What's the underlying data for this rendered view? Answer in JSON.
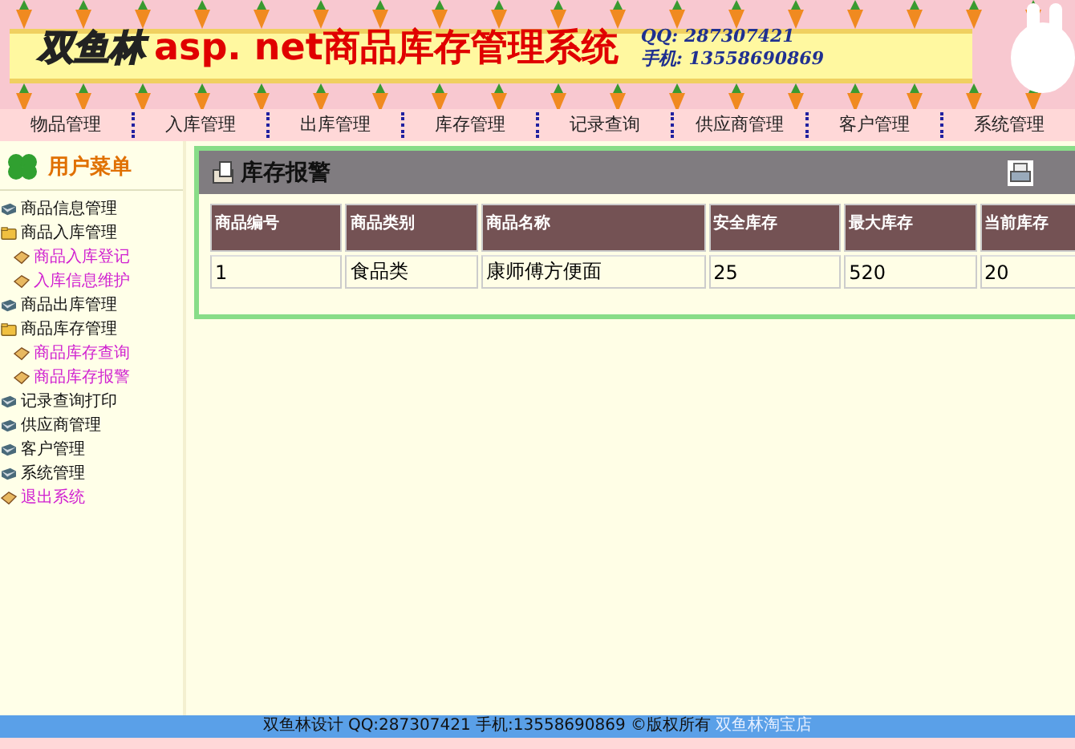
{
  "banner": {
    "brand": "双鱼林",
    "title": "asp. net商品库存管理系统",
    "qq": "QQ: 287307421",
    "phone": "手机: 13558690869"
  },
  "nav": [
    "物品管理",
    "入库管理",
    "出库管理",
    "库存管理",
    "记录查询",
    "供应商管理",
    "客户管理",
    "系统管理"
  ],
  "sidebar": {
    "title": "用户菜单",
    "items": [
      {
        "label": "商品信息管理",
        "kind": "module",
        "expanded": false
      },
      {
        "label": "商品入库管理",
        "kind": "module",
        "expanded": true,
        "children": [
          {
            "label": "商品入库登记",
            "kind": "link"
          },
          {
            "label": "入库信息维护",
            "kind": "link"
          }
        ]
      },
      {
        "label": "商品出库管理",
        "kind": "module",
        "expanded": false
      },
      {
        "label": "商品库存管理",
        "kind": "module",
        "expanded": true,
        "children": [
          {
            "label": "商品库存查询",
            "kind": "link"
          },
          {
            "label": "商品库存报警",
            "kind": "link"
          }
        ]
      },
      {
        "label": "记录查询打印",
        "kind": "module",
        "expanded": false
      },
      {
        "label": "供应商管理",
        "kind": "module",
        "expanded": false
      },
      {
        "label": "客户管理",
        "kind": "module",
        "expanded": false
      },
      {
        "label": "系统管理",
        "kind": "module",
        "expanded": false
      },
      {
        "label": "退出系统",
        "kind": "link"
      }
    ]
  },
  "panel": {
    "title": "库存报警",
    "table": {
      "columns": [
        "商品编号",
        "商品类别",
        "商品名称",
        "安全库存",
        "最大库存",
        "当前库存"
      ],
      "rows": [
        [
          "1",
          "食品类",
          "康师傅方便面",
          "25",
          "520",
          "20"
        ]
      ]
    }
  },
  "footer": {
    "text": "双鱼林设计  QQ:287307421 手机:13558690869 ©版权所有",
    "link": "双鱼林淘宝店"
  }
}
